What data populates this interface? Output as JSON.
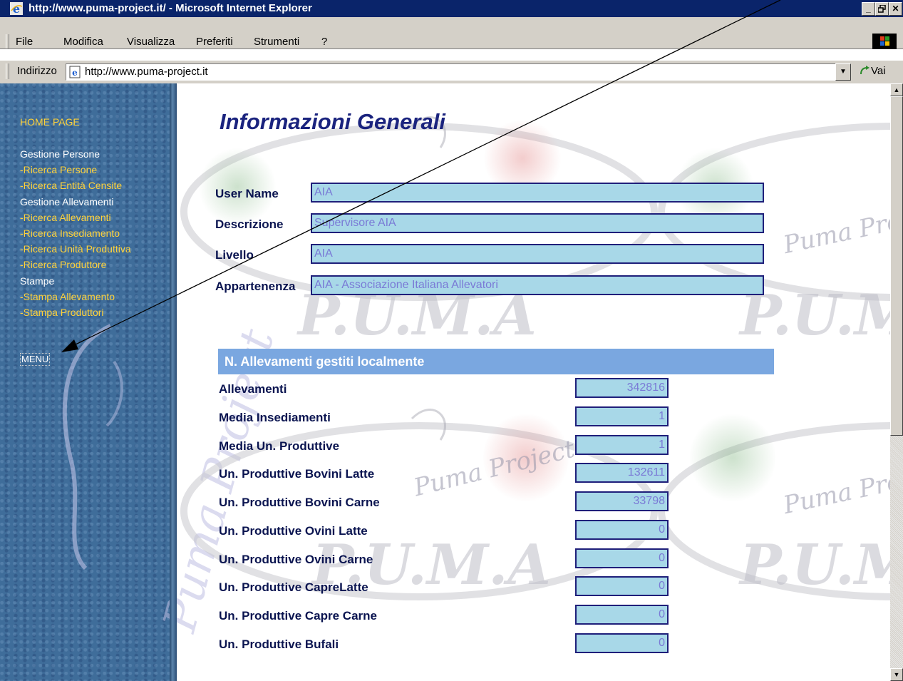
{
  "window": {
    "title": "http://www.puma-project.it/ - Microsoft Internet Explorer",
    "controls": [
      "_",
      "̲❐",
      "X"
    ]
  },
  "menubar": {
    "items": [
      "File",
      "Modifica",
      "Visualizza",
      "Preferiti",
      "Strumenti",
      "?"
    ]
  },
  "addressbar": {
    "label": "Indirizzo",
    "url": "http://www.puma-project.it",
    "go_label": "Vai"
  },
  "sidebar": {
    "home": "HOME PAGE",
    "nav": [
      {
        "text": "Gestione Persone",
        "kind": "heading"
      },
      {
        "text": "-Ricerca Persone",
        "kind": "link"
      },
      {
        "text": "-Ricerca Entità Censite",
        "kind": "link"
      },
      {
        "text": "Gestione Allevamenti",
        "kind": "heading"
      },
      {
        "text": "-Ricerca Allevamenti",
        "kind": "link"
      },
      {
        "text": "-Ricerca Insediamento",
        "kind": "link"
      },
      {
        "text": "-Ricerca Unità Produttiva",
        "kind": "link"
      },
      {
        "text": "-Ricerca Produttore",
        "kind": "link"
      },
      {
        "text": "Stampe",
        "kind": "heading"
      },
      {
        "text": "-Stampa Allevamento",
        "kind": "link"
      },
      {
        "text": "-Stampa Produttori",
        "kind": "link"
      }
    ],
    "menu_label": "MENU"
  },
  "main": {
    "title": "Informazioni Generali",
    "info": [
      {
        "label": "User Name",
        "value": "AIA"
      },
      {
        "label": "Descrizione",
        "value": "Supervisore AIA"
      },
      {
        "label": "Livello",
        "value": "AIA"
      },
      {
        "label": "Appartenenza",
        "value": "AIA - Associazione Italiana Allevatori"
      }
    ],
    "section_title": "N. Allevamenti gestiti localmente",
    "stats": [
      {
        "label": "Allevamenti",
        "value": "342816"
      },
      {
        "label": "Media Insediamenti",
        "value": "1"
      },
      {
        "label": "Media Un. Produttive",
        "value": "1"
      },
      {
        "label": "Un. Produttive Bovini Latte",
        "value": "132611"
      },
      {
        "label": "Un. Produttive Bovini Carne",
        "value": "33798"
      },
      {
        "label": "Un. Produttive Ovini Latte",
        "value": "0"
      },
      {
        "label": "Un. Produttive Ovini Carne",
        "value": "0"
      },
      {
        "label": "Un. Produttive CapreLatte",
        "value": "0"
      },
      {
        "label": "Un. Produttive Capre Carne",
        "value": "0"
      },
      {
        "label": "Un. Produttive Bufali",
        "value": "0"
      }
    ]
  },
  "colors": {
    "title_bar": "#0a246a",
    "sidebar": "#3f6d9a",
    "nav_link": "#ffd23a",
    "field_bg": "#a8d8e8",
    "section_header": "#7aa7e0",
    "title_text": "#1a237e"
  }
}
